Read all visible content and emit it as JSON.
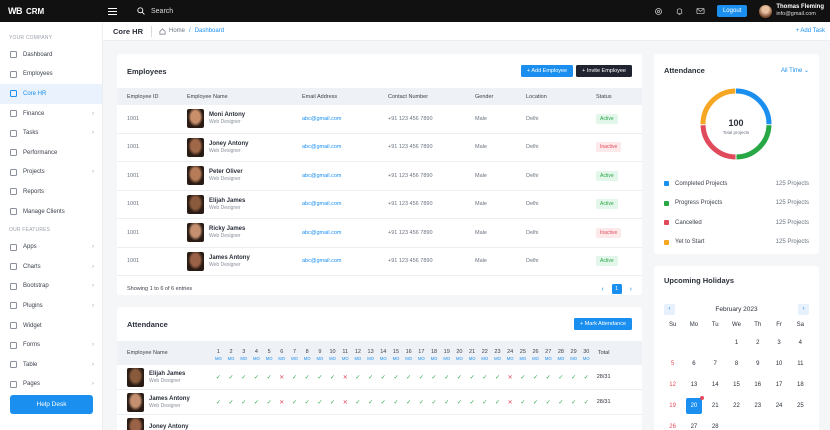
{
  "brand": {
    "logo": "WB",
    "name": "CRM"
  },
  "topbar": {
    "search": "Search",
    "logout": "Logout",
    "user_name": "Thomas Fleming",
    "user_email": "info@gmail.com"
  },
  "sidebar": {
    "group1": "YOUR COMPANY",
    "items1": [
      {
        "label": "Dashboard",
        "chev": false
      },
      {
        "label": "Employees",
        "chev": false
      },
      {
        "label": "Core HR",
        "chev": false
      },
      {
        "label": "Finance",
        "chev": true
      },
      {
        "label": "Tasks",
        "chev": true
      },
      {
        "label": "Performance",
        "chev": false
      },
      {
        "label": "Projects",
        "chev": true
      },
      {
        "label": "Reports",
        "chev": false
      },
      {
        "label": "Manage Clients",
        "chev": false
      }
    ],
    "group2": "OUR FEATURES",
    "items2": [
      {
        "label": "Apps",
        "chev": true
      },
      {
        "label": "Charts",
        "chev": true
      },
      {
        "label": "Bootstrap",
        "chev": true
      },
      {
        "label": "Plugins",
        "chev": true
      },
      {
        "label": "Widget",
        "chev": false
      },
      {
        "label": "Forms",
        "chev": true
      },
      {
        "label": "Table",
        "chev": true
      },
      {
        "label": "Pages",
        "chev": true
      }
    ],
    "help": "Help Desk"
  },
  "breadcrumb": {
    "title": "Core HR",
    "home": "Home",
    "current": "Dashboard",
    "add_task": "+ Add Task"
  },
  "employees": {
    "title": "Employees",
    "add_btn": "+ Add Employee",
    "invite_btn": "+ Invite Employee",
    "columns": [
      "Employee ID",
      "Employee Name",
      "Email Address",
      "Contact Number",
      "Gender",
      "Location",
      "Status"
    ],
    "rows": [
      {
        "id": "1001",
        "name": "Moni Antony",
        "role": "Web Designer",
        "email": "abc@gmail.com",
        "phone": "+91 123 456 7890",
        "gender": "Male",
        "location": "Delhi",
        "status": "Active"
      },
      {
        "id": "1001",
        "name": "Joney Antony",
        "role": "Web Designer",
        "email": "abc@gmail.com",
        "phone": "+91 123 456 7890",
        "gender": "Male",
        "location": "Delhi",
        "status": "Inactive"
      },
      {
        "id": "1001",
        "name": "Peter Oliver",
        "role": "Web Designer",
        "email": "abc@gmail.com",
        "phone": "+91 123 456 7890",
        "gender": "Male",
        "location": "Delhi",
        "status": "Active"
      },
      {
        "id": "1001",
        "name": "Elijah James",
        "role": "Web Designer",
        "email": "abc@gmail.com",
        "phone": "+91 123 456 7890",
        "gender": "Male",
        "location": "Delhi",
        "status": "Active"
      },
      {
        "id": "1001",
        "name": "Ricky James",
        "role": "Web Designer",
        "email": "abc@gmail.com",
        "phone": "+91 123 456 7890",
        "gender": "Male",
        "location": "Delhi",
        "status": "Inactive"
      },
      {
        "id": "1001",
        "name": "James Antony",
        "role": "Web Designer",
        "email": "abc@gmail.com",
        "phone": "+91 123 456 7890",
        "gender": "Male",
        "location": "Delhi",
        "status": "Active"
      }
    ],
    "showing": "Showing 1 to 6 of 6 entries",
    "page": "1"
  },
  "attendance_table": {
    "title": "Attendance",
    "mark_btn": "+ Mark Attendance",
    "col_name": "Employee Name",
    "col_total": "Total",
    "day_suffix": "MO",
    "days": [
      "1",
      "2",
      "3",
      "4",
      "5",
      "6",
      "7",
      "8",
      "9",
      "10",
      "11",
      "12",
      "13",
      "14",
      "15",
      "16",
      "17",
      "18",
      "19",
      "20",
      "21",
      "22",
      "23",
      "24",
      "25",
      "26",
      "27",
      "28",
      "29",
      "30"
    ],
    "rows": [
      {
        "name": "Elijah James",
        "role": "Web Designer",
        "total": "28/31",
        "marks": "yyyyyxyyyyxyyyyyyyyyyyyxyyyyyy"
      },
      {
        "name": "James Antony",
        "role": "Web Designer",
        "total": "28/31",
        "marks": "yyyyyxyyyyxyyyyyyyyyyyyxyyyyyy"
      },
      {
        "name": "Joney Antony",
        "role": "",
        "total": "",
        "marks": ""
      }
    ]
  },
  "attendance_summary": {
    "title": "Attendance",
    "filter": "All Time",
    "center_value": "100",
    "center_label": "Total projects",
    "legend": [
      {
        "label": "Completed Projects",
        "value": "125 Projects",
        "color": "#1a8ff0"
      },
      {
        "label": "Progress Projects",
        "value": "125 Projects",
        "color": "#28a745"
      },
      {
        "label": "Cancelled",
        "value": "125 Projects",
        "color": "#e04a5a"
      },
      {
        "label": "Yet to Start",
        "value": "125 Projects",
        "color": "#f5a623"
      }
    ]
  },
  "holidays": {
    "title": "Upcoming Holidays",
    "month": "February 2023",
    "weekdays": [
      "Su",
      "Mo",
      "Tu",
      "We",
      "Th",
      "Fr",
      "Sa"
    ],
    "weeks": [
      [
        "",
        "",
        "",
        "1",
        "2",
        "3",
        "4"
      ],
      [
        "5",
        "6",
        "7",
        "8",
        "9",
        "10",
        "11"
      ],
      [
        "12",
        "13",
        "14",
        "15",
        "16",
        "17",
        "18"
      ],
      [
        "19",
        "20",
        "21",
        "22",
        "23",
        "24",
        "25"
      ],
      [
        "26",
        "27",
        "28",
        "",
        "",
        "",
        ""
      ]
    ],
    "today": "20"
  }
}
